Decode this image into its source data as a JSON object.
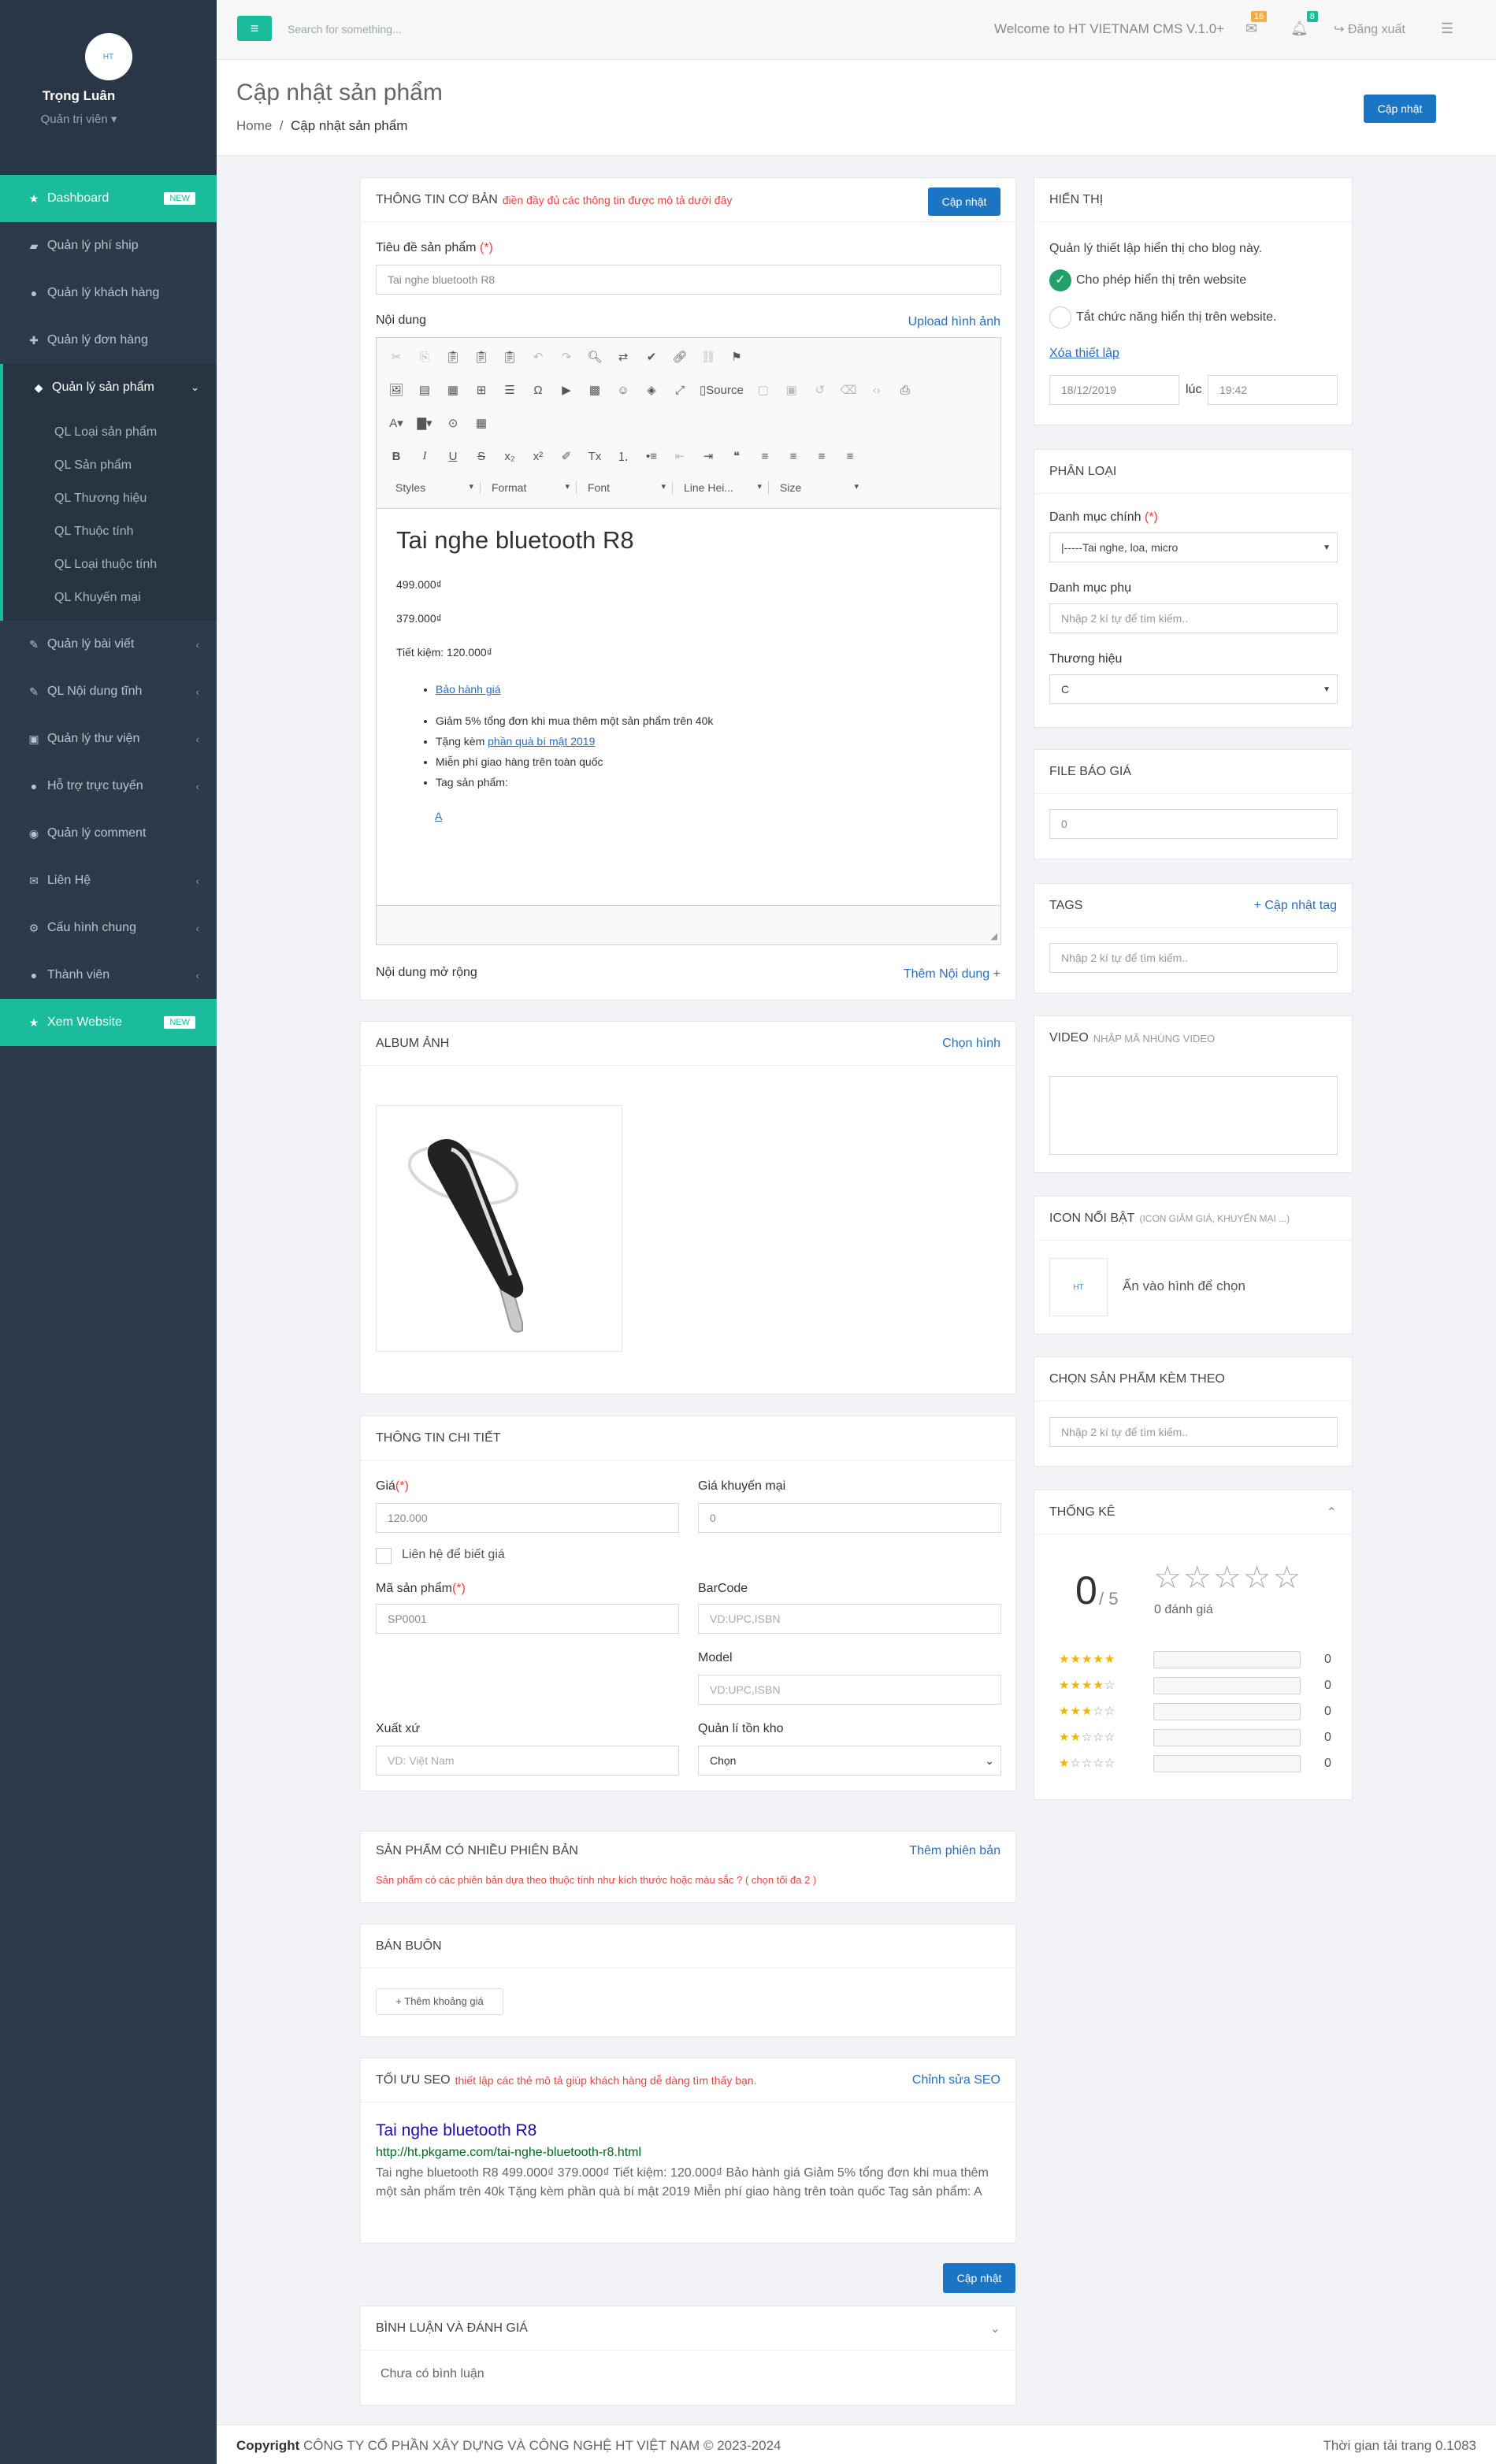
{
  "sidebar": {
    "user_name": "Trọng Luân",
    "user_role": "Quản trị viên",
    "avatar_text": "HT",
    "items": [
      {
        "label": "Dashboard",
        "badge": "NEW"
      },
      {
        "label": "Quản lý phí ship"
      },
      {
        "label": "Quản lý khách hàng"
      },
      {
        "label": "Quản lý đơn hàng"
      },
      {
        "label": "Quản lý sản phẩm"
      },
      {
        "label": "Quản lý bài viết"
      },
      {
        "label": "QL Nội dung tĩnh"
      },
      {
        "label": "Quản lý thư viện"
      },
      {
        "label": "Hỗ trợ trực tuyến"
      },
      {
        "label": "Quản lý comment"
      },
      {
        "label": "Liên Hệ"
      },
      {
        "label": "Cấu hình chung"
      },
      {
        "label": "Thành viên"
      },
      {
        "label": "Xem Website",
        "badge": "NEW"
      }
    ],
    "subitems": [
      "QL Loại sản phẩm",
      "QL Sản phẩm",
      "QL Thương hiệu",
      "QL Thuộc tính",
      "QL Loại thuộc tính",
      "QL Khuyến mại"
    ]
  },
  "topbar": {
    "search_placeholder": "Search for something...",
    "welcome": "Welcome to HT VIETNAM CMS V.1.0+",
    "mail_count": "16",
    "bell_count": "8",
    "logout": "Đăng xuất"
  },
  "page": {
    "title": "Cập nhật sản phẩm",
    "bc_home": "Home",
    "bc_current": "Cập nhật sản phẩm",
    "update_btn": "Cập nhật"
  },
  "basic": {
    "title": "THÔNG TIN CƠ BẢN",
    "subtitle": "điền đầy đủ các thông tin được mô tả dưới đây",
    "btn": "Cập nhật",
    "name_label": "Tiêu đề sản phẩm",
    "required": "(*)",
    "name_value": "Tai nghe bluetooth R8",
    "content_label": "Nội dung",
    "upload_link": "Upload hình ảnh",
    "toolbar": {
      "source": "Source",
      "styles": "Styles",
      "format": "Format",
      "font": "Font",
      "line_height": "Line Hei...",
      "size": "Size"
    },
    "content": {
      "heading": "Tai nghe bluetooth R8",
      "price1": "499.000₫",
      "price2": "379.000₫",
      "saving": "Tiết kiệm: 120.000₫",
      "warranty": "Bảo hành giá",
      "b1": "Giảm 5% tổng đơn khi mua thêm một sản phẩm trên 40k",
      "b2_pre": "Tặng kèm ",
      "b2_link": "phần quà bí mật 2019",
      "b3": "Miễn phí giao hàng trên toàn quốc",
      "b4": "Tag sản phẩm:",
      "tag": "A"
    },
    "ext_label": "Nội dung mở rộng",
    "ext_link": "Thêm Nội dung +"
  },
  "album": {
    "title": "ALBUM ẢNH",
    "link": "Chọn hình"
  },
  "detail": {
    "title": "THÔNG TIN CHI TIẾT",
    "price_label": "Giá",
    "price": "120.000",
    "promo_label": "Giá khuyến mại",
    "promo": "0",
    "contact": "Liên hệ để biết giá",
    "sku_label": "Mã sản phẩm",
    "sku": "SP0001",
    "barcode_label": "BarCode",
    "barcode_ph": "VD:UPC,ISBN",
    "model_label": "Model",
    "model_ph": "VD:UPC,ISBN",
    "origin_label": "Xuất xứ",
    "origin_ph": "VD: Việt Nam",
    "stock_label": "Quản lí tồn kho",
    "stock": "Chọn"
  },
  "variants": {
    "title": "SẢN PHẨM CÓ NHIỀU PHIÊN BẢN",
    "link": "Thêm phiên bản",
    "note": "Sản phẩm có các phiên bản dựa theo thuộc tính như kích thước hoặc màu sắc ? ( chọn tối đa 2 )"
  },
  "wholesale": {
    "title": "BÁN BUÔN",
    "btn": "+ Thêm khoảng giá"
  },
  "seo": {
    "title": "TỐI ƯU SEO",
    "subtitle": "thiết lập các thẻ mô tả giúp khách hàng dễ dàng tìm thấy bạn.",
    "link": "Chỉnh sửa SEO",
    "preview_title": "Tai nghe bluetooth R8",
    "url": "http://ht.pkgame.com/tai-nghe-bluetooth-r8.html",
    "desc": "Tai nghe bluetooth R8 499.000₫ 379.000₫ Tiết kiệm: 120.000₫ Bảo hành giá Giảm 5% tổng đơn khi mua thêm một sản phẩm trên 40k Tặng kèm phần quà bí mật 2019 Miễn phí giao hàng trên toàn quốc Tag sản phẩm:  A"
  },
  "bottom_btn": "Cập nhật",
  "comments": {
    "title": "BÌNH LUẬN VÀ ĐÁNH GIÁ",
    "empty": "Chưa có bình luận"
  },
  "display": {
    "title": "HIỂN THỊ",
    "desc": "Quản lý thiết lập hiển thị cho blog này.",
    "opt1": "Cho phép hiển thị trên website",
    "opt2": "Tắt chức năng hiển thị trên website.",
    "reset": "Xóa thiết lập",
    "date": "18/12/2019",
    "at": "lúc",
    "time": "19:42"
  },
  "category": {
    "title": "PHÂN LOẠI",
    "main_label": "Danh mục chính",
    "main_value": "|-----Tai nghe, loa, micro",
    "sub_label": "Danh mục phụ",
    "sub_ph": "Nhập 2 kí tự để tìm kiếm..",
    "brand_label": "Thương hiệu",
    "brand_value": "C"
  },
  "quote": {
    "title": "FILE BÁO GIÁ",
    "value": "0"
  },
  "tags": {
    "title": "TAGS",
    "link": "+ Cập nhật tag",
    "ph": "Nhập 2 kí tự để tìm kiếm.."
  },
  "video": {
    "title": "VIDEO",
    "subtitle": "NHẬP MÃ NHÚNG VIDEO"
  },
  "icon": {
    "title": "ICON NỔI BẬT",
    "subtitle": "(ICON GIẢM GIÁ, KHUYẾN MẠI ...)",
    "hint": "Ấn vào hình để chọn"
  },
  "related": {
    "title": "CHỌN SẢN PHẨM KÈM THEO",
    "ph": "Nhập 2 kí tự để tìm kiếm.."
  },
  "stats": {
    "title": "THỐNG KÊ",
    "score": "0",
    "out_of": "/ 5",
    "reviews": "0 đánh giá",
    "rows": [
      {
        "stars": 5,
        "count": "0"
      },
      {
        "stars": 4,
        "count": "0"
      },
      {
        "stars": 3,
        "count": "0"
      },
      {
        "stars": 2,
        "count": "0"
      },
      {
        "stars": 1,
        "count": "0"
      }
    ]
  },
  "footer": {
    "copyright": "Copyright",
    "company": "CÔNG TY CỔ PHẦN XÂY DỰNG VÀ CÔNG NGHỆ HT VIỆT NAM © 2023-2024",
    "load_time": "Thời gian tải trang 0.1083"
  },
  "colors": {
    "accent": "#1abc9c",
    "primary": "#1a76c4",
    "sidebar": "#2c3b4a",
    "danger": "#e8433f"
  }
}
